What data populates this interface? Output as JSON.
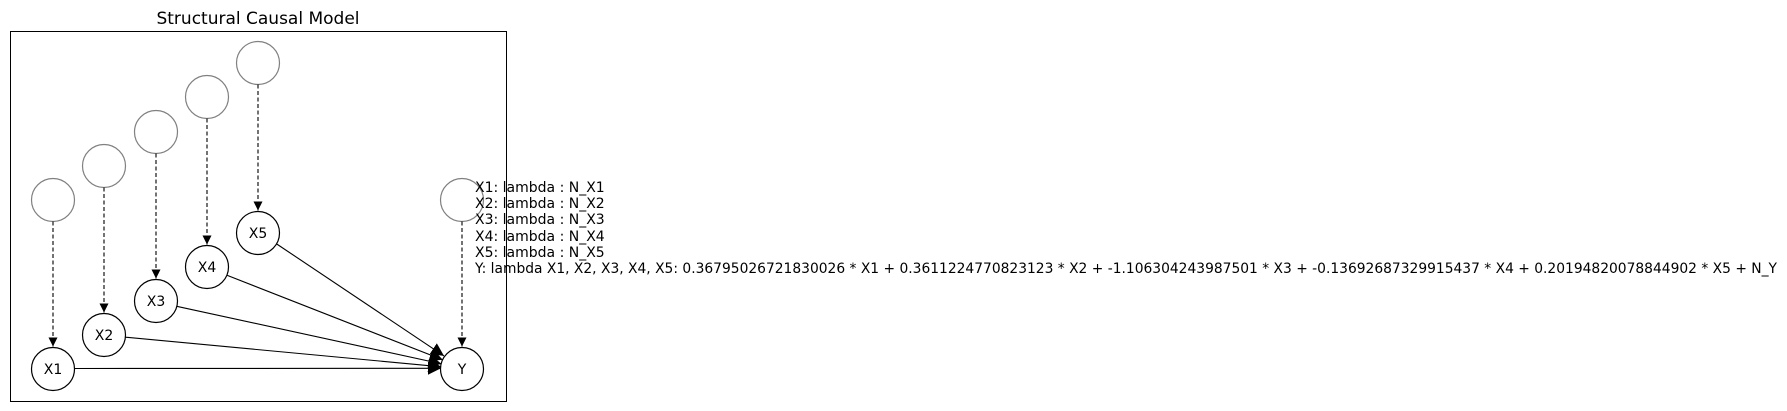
{
  "title": "Structural Causal Model",
  "nodes": {
    "x1": {
      "label": "X1"
    },
    "x2": {
      "label": "X2"
    },
    "x3": {
      "label": "X3"
    },
    "x4": {
      "label": "X4"
    },
    "x5": {
      "label": "X5"
    },
    "y": {
      "label": "Y"
    }
  },
  "equations": [
    "X1: lambda : N_X1",
    "X2: lambda : N_X2",
    "X3: lambda : N_X3",
    "X4: lambda : N_X4",
    "X5: lambda : N_X5",
    "Y: lambda X1, X2, X3, X4, X5: 0.36795026721830026 * X1 + 0.3611224770823123 * X2 + -1.106304243987501 * X3 + -0.13692687329915437 * X4 + 0.20194820078844902 * X5 + N_Y"
  ],
  "colors": {
    "node_stroke": "#000000",
    "noise_stroke": "#808080",
    "edge": "#000000"
  }
}
